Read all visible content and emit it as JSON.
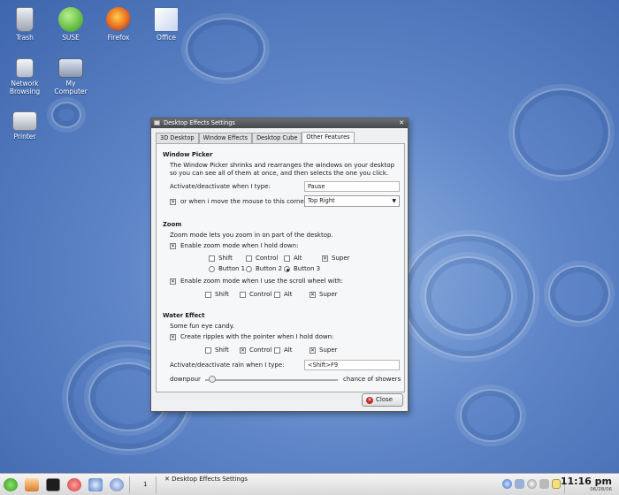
{
  "desktop": {
    "icons": [
      {
        "label": "Trash",
        "icon": "trash-icon"
      },
      {
        "label": "SUSE",
        "icon": "suse-icon"
      },
      {
        "label": "Firefox",
        "icon": "firefox-icon"
      },
      {
        "label": "Office",
        "icon": "office-icon"
      },
      {
        "label": "Network Browsing",
        "icon": "network-icon"
      },
      {
        "label": "My Computer",
        "icon": "computer-icon"
      },
      {
        "label": "Printer",
        "icon": "printer-icon"
      }
    ]
  },
  "window": {
    "title": "Desktop Effects Settings",
    "tabs": [
      "3D Desktop",
      "Window Effects",
      "Desktop Cube",
      "Other Features"
    ],
    "active_tab": "Other Features",
    "window_picker": {
      "heading": "Window Picker",
      "desc_line1": "The Window Picker shrinks and rearranges the windows on your desktop",
      "desc_line2": "so you can see all of them at once, and then selects the one you click.",
      "activate_label": "Activate/deactivate when I type:",
      "activate_value": "Pause",
      "corner_label": "or when i move the mouse to this corner:",
      "corner_checked": true,
      "corner_value": "Top Right"
    },
    "zoom": {
      "heading": "Zoom",
      "desc": "Zoom mode lets you zoom in on part of the desktop.",
      "enable_hold_label": "Enable zoom mode when I hold down:",
      "enable_hold_checked": true,
      "modifiers": [
        {
          "label": "Shift",
          "checked": false
        },
        {
          "label": "Control",
          "checked": false
        },
        {
          "label": "Alt",
          "checked": false
        },
        {
          "label": "Super",
          "checked": true
        }
      ],
      "buttons": [
        {
          "label": "Button 1",
          "selected": false
        },
        {
          "label": "Button 2",
          "selected": false
        },
        {
          "label": "Button 3",
          "selected": true
        }
      ],
      "enable_scroll_label": "Enable zoom mode when I use the scroll wheel with:",
      "enable_scroll_checked": true,
      "scroll_modifiers": [
        {
          "label": "Shift",
          "checked": false
        },
        {
          "label": "Control",
          "checked": false
        },
        {
          "label": "Alt",
          "checked": false
        },
        {
          "label": "Super",
          "checked": true
        }
      ]
    },
    "water": {
      "heading": "Water Effect",
      "desc": "Some fun eye candy.",
      "ripples_label": "Create ripples with the pointer when I hold down:",
      "ripples_checked": true,
      "modifiers": [
        {
          "label": "Shift",
          "checked": false
        },
        {
          "label": "Control",
          "checked": true
        },
        {
          "label": "Alt",
          "checked": false
        },
        {
          "label": "Super",
          "checked": true
        }
      ],
      "rain_label": "Activate/deactivate rain when I type:",
      "rain_value": "<Shift>F9",
      "slider_left": "downpour",
      "slider_right": "chance of showers",
      "slider_level": 0.05
    },
    "close_label": "Close"
  },
  "taskbar": {
    "workspace": "1",
    "task_label": "Desktop Effects Settings",
    "time": "11:16 pm",
    "date": "06/28/06"
  }
}
